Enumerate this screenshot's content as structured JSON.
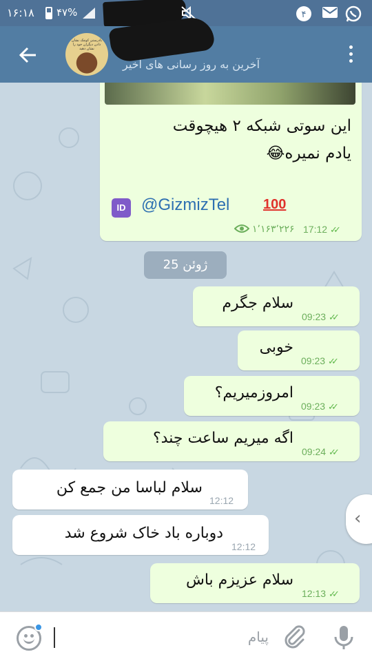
{
  "status_bar": {
    "time": "۱۶:۱۸",
    "battery": "۴۷%"
  },
  "header": {
    "status": "آخرین به روز رسانی های اخیر",
    "avatar_text": "بادرستی کوچک نشان دادن دیگران خود را نشان دهید"
  },
  "messages_top": {
    "text_line1": "این سوتی شبکه ۲ هیچوقت",
    "text_line2": "یادم نمیره😂",
    "id_icon": "🆔",
    "link": "@GizmizTel",
    "hundred": "💯",
    "views": "۱٬۱۶۳٬۲۲۶",
    "time": "17:12"
  },
  "date_chip": "ژوئن 25",
  "messages": [
    {
      "side": "out",
      "text": "سلام جگرم",
      "time": "09:23"
    },
    {
      "side": "out",
      "text": "خوبی",
      "time": "09:23"
    },
    {
      "side": "out",
      "text": "امروزمیریم؟",
      "time": "09:23"
    },
    {
      "side": "out",
      "text": "اگه میریم ساعت چند؟",
      "time": "09:24"
    },
    {
      "side": "in",
      "text": "سلام لباسا من جمع کن",
      "time": "12:12"
    },
    {
      "side": "in",
      "text": "دوباره باد خاک شروع شد",
      "time": "12:12"
    },
    {
      "side": "out",
      "text": "سلام عزیزم باش",
      "time": "12:13"
    }
  ],
  "input": {
    "placeholder": "پیام"
  },
  "colors": {
    "header": "#527da3",
    "status_bar": "#4f7297",
    "outgoing_bubble": "#eeffde",
    "incoming_bubble": "#ffffff",
    "chat_background": "#c8d7e2",
    "link": "#2d6fb1"
  },
  "icons": {
    "back": "arrow-left-icon",
    "menu": "more-vertical-icon",
    "emoji": "smile-icon",
    "attach": "paperclip-icon",
    "mic": "microphone-icon",
    "scroll": "chevron-left-icon",
    "views": "eye-icon"
  }
}
